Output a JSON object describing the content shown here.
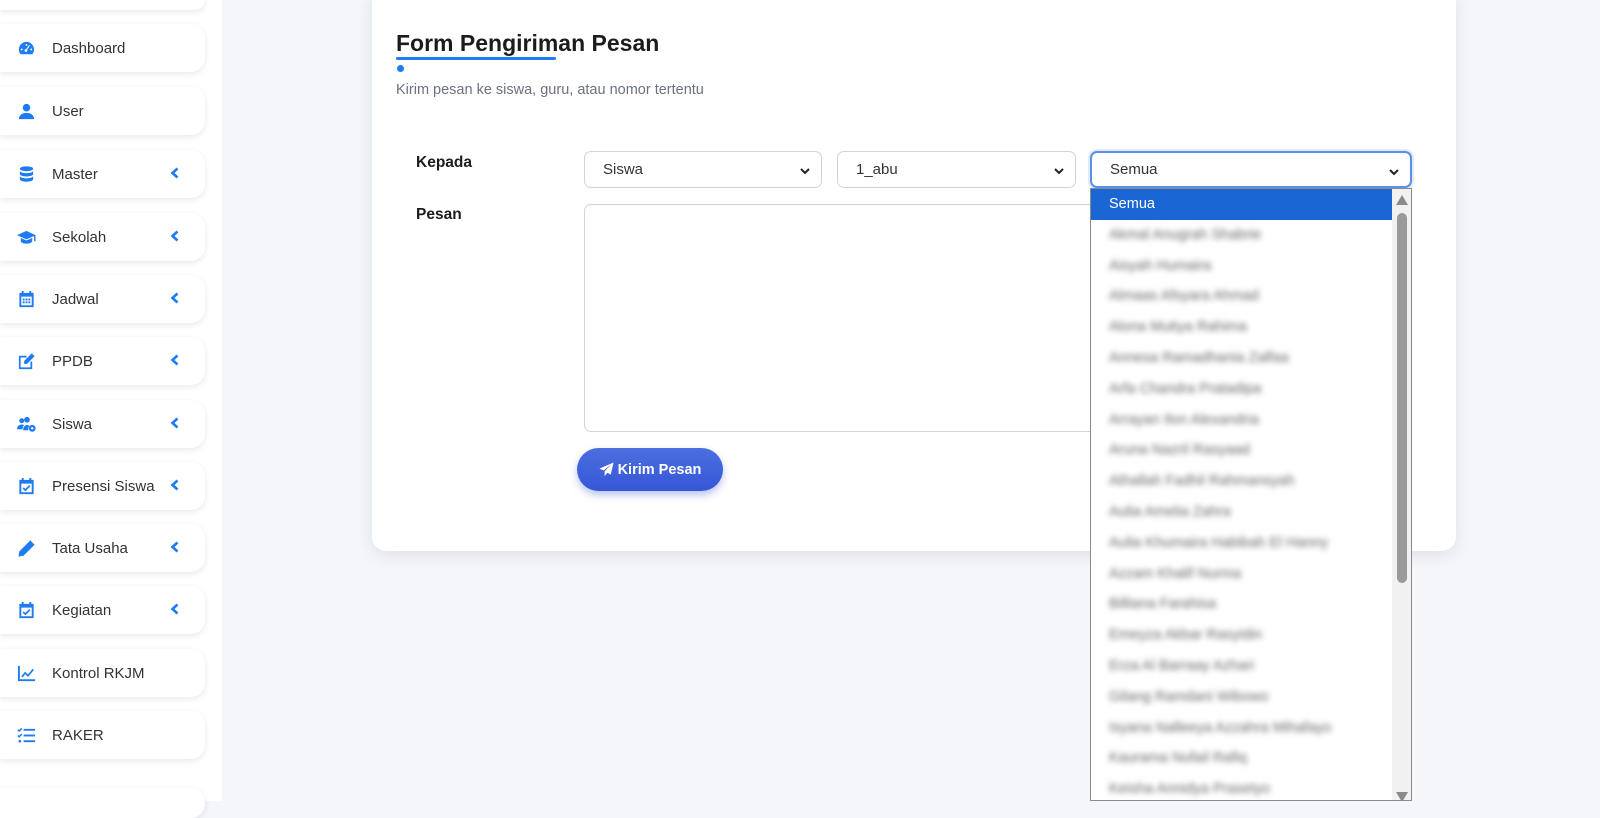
{
  "sidebar": {
    "items": [
      {
        "label": "Dashboard",
        "icon": "gauge-icon",
        "has_submenu": false
      },
      {
        "label": "User",
        "icon": "user-icon",
        "has_submenu": false
      },
      {
        "label": "Master",
        "icon": "database-icon",
        "has_submenu": true
      },
      {
        "label": "Sekolah",
        "icon": "graduation-cap-icon",
        "has_submenu": true
      },
      {
        "label": "Jadwal",
        "icon": "calendar-icon",
        "has_submenu": true
      },
      {
        "label": "PPDB",
        "icon": "edit-icon",
        "has_submenu": true
      },
      {
        "label": "Siswa",
        "icon": "users-gear-icon",
        "has_submenu": true
      },
      {
        "label": "Presensi Siswa",
        "icon": "calendar-check-icon",
        "has_submenu": true
      },
      {
        "label": "Tata Usaha",
        "icon": "pencil-icon",
        "has_submenu": true
      },
      {
        "label": "Kegiatan",
        "icon": "calendar-check-icon",
        "has_submenu": true
      },
      {
        "label": "Kontrol RKJM",
        "icon": "chart-line-icon",
        "has_submenu": false
      },
      {
        "label": "RAKER",
        "icon": "list-check-icon",
        "has_submenu": false
      }
    ]
  },
  "form": {
    "title": "Form Pengiriman Pesan",
    "subtitle": "Kirim pesan ke siswa, guru, atau nomor tertentu",
    "to_label": "Kepada",
    "message_label": "Pesan",
    "recipient_type": "Siswa",
    "class": "1_abu",
    "student": "Semua",
    "message_value": "",
    "send_label": "Kirim Pesan"
  },
  "dropdown": {
    "options": [
      "Semua",
      "Akmal Anugrah Shabrie",
      "Aisyah Humaira",
      "Almaas Afsyara Ahmad",
      "Alona Mutiya Rahima",
      "Annesa Ramadhania Zalfaa",
      "Arfa Chandra Pratadipa",
      "Arrayan Ilon Alexandria",
      "Aruna Nazril Rasyaad",
      "Athallah Fadhil Rahmansyah",
      "Aulia Amelia Zahra",
      "Aulia Khumaira Habibah El Hanny",
      "Azzam Khalif Nurma",
      "Billiana Farahisa",
      "Emeyza Akbar Rasyidin",
      "Erza Al Barraay Azhari",
      "Gilang Ramdani Wibowo",
      "Isyana Nalleeya Azzahra Mihafayo",
      "Kaurama Nufail Rafiq",
      "Keisha Annidya Prasetyo"
    ],
    "selected_index": 0
  }
}
